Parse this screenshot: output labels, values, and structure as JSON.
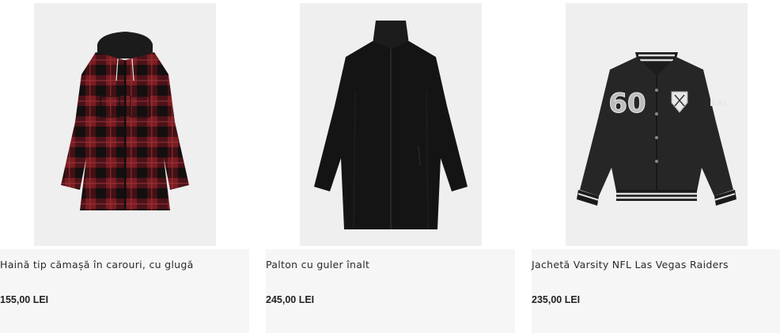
{
  "products": [
    {
      "name": "Haină tip cămașă în carouri, cu glugă",
      "price": "155,00 LEI"
    },
    {
      "name": "Palton cu guler înalt",
      "price": "245,00 LEI"
    },
    {
      "name": "Jachetă Varsity NFL Las Vegas Raiders",
      "price": "235,00 LEI",
      "number_print": "60",
      "sleeve_print": "RAI"
    }
  ],
  "colors": {
    "tile_bg": "#efefef",
    "info_bg": "#f6f6f6",
    "plaid_red": "#7a1d22",
    "plaid_black": "#1a1414",
    "coat_black": "#141414"
  }
}
